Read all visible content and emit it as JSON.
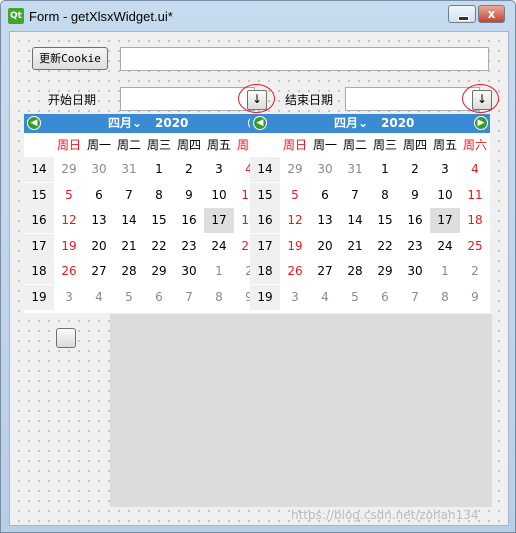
{
  "window": {
    "title": "Form - getXlsxWidget.ui*",
    "logo_text": "Qt",
    "close_glyph": "x"
  },
  "form": {
    "refresh_button": "更新Cookie",
    "start_label": "开始日期",
    "end_label": "结束日期",
    "drop_glyph": "↓",
    "highlight_color": "#e21b1b"
  },
  "calendar": {
    "month": "四月",
    "month_arrow": "⌄",
    "year": "2020",
    "weekday_headers": [
      "周日",
      "周一",
      "周二",
      "周三",
      "周四",
      "周五",
      "周六"
    ],
    "week_numbers": [
      "14",
      "15",
      "16",
      "17",
      "18",
      "19"
    ],
    "days": [
      [
        "29",
        "30",
        "31",
        "1",
        "2",
        "3",
        "4"
      ],
      [
        "5",
        "6",
        "7",
        "8",
        "9",
        "10",
        "11"
      ],
      [
        "12",
        "13",
        "14",
        "15",
        "16",
        "17",
        "18"
      ],
      [
        "19",
        "20",
        "21",
        "22",
        "23",
        "24",
        "25"
      ],
      [
        "26",
        "27",
        "28",
        "29",
        "30",
        "1",
        "2"
      ],
      [
        "3",
        "4",
        "5",
        "6",
        "7",
        "8",
        "9"
      ]
    ],
    "other_month_marks": [
      [
        1,
        1,
        1,
        0,
        0,
        0,
        0
      ],
      [
        0,
        0,
        0,
        0,
        0,
        0,
        0
      ],
      [
        0,
        0,
        0,
        0,
        0,
        0,
        0
      ],
      [
        0,
        0,
        0,
        0,
        0,
        0,
        0
      ],
      [
        0,
        0,
        0,
        0,
        0,
        1,
        1
      ],
      [
        1,
        1,
        1,
        1,
        1,
        1,
        1
      ]
    ],
    "selected": "17",
    "weekend_color": "#e8191c",
    "nav_color": "#3a8ad4"
  },
  "watermark": "https://blog.csdn.net/zohan134"
}
